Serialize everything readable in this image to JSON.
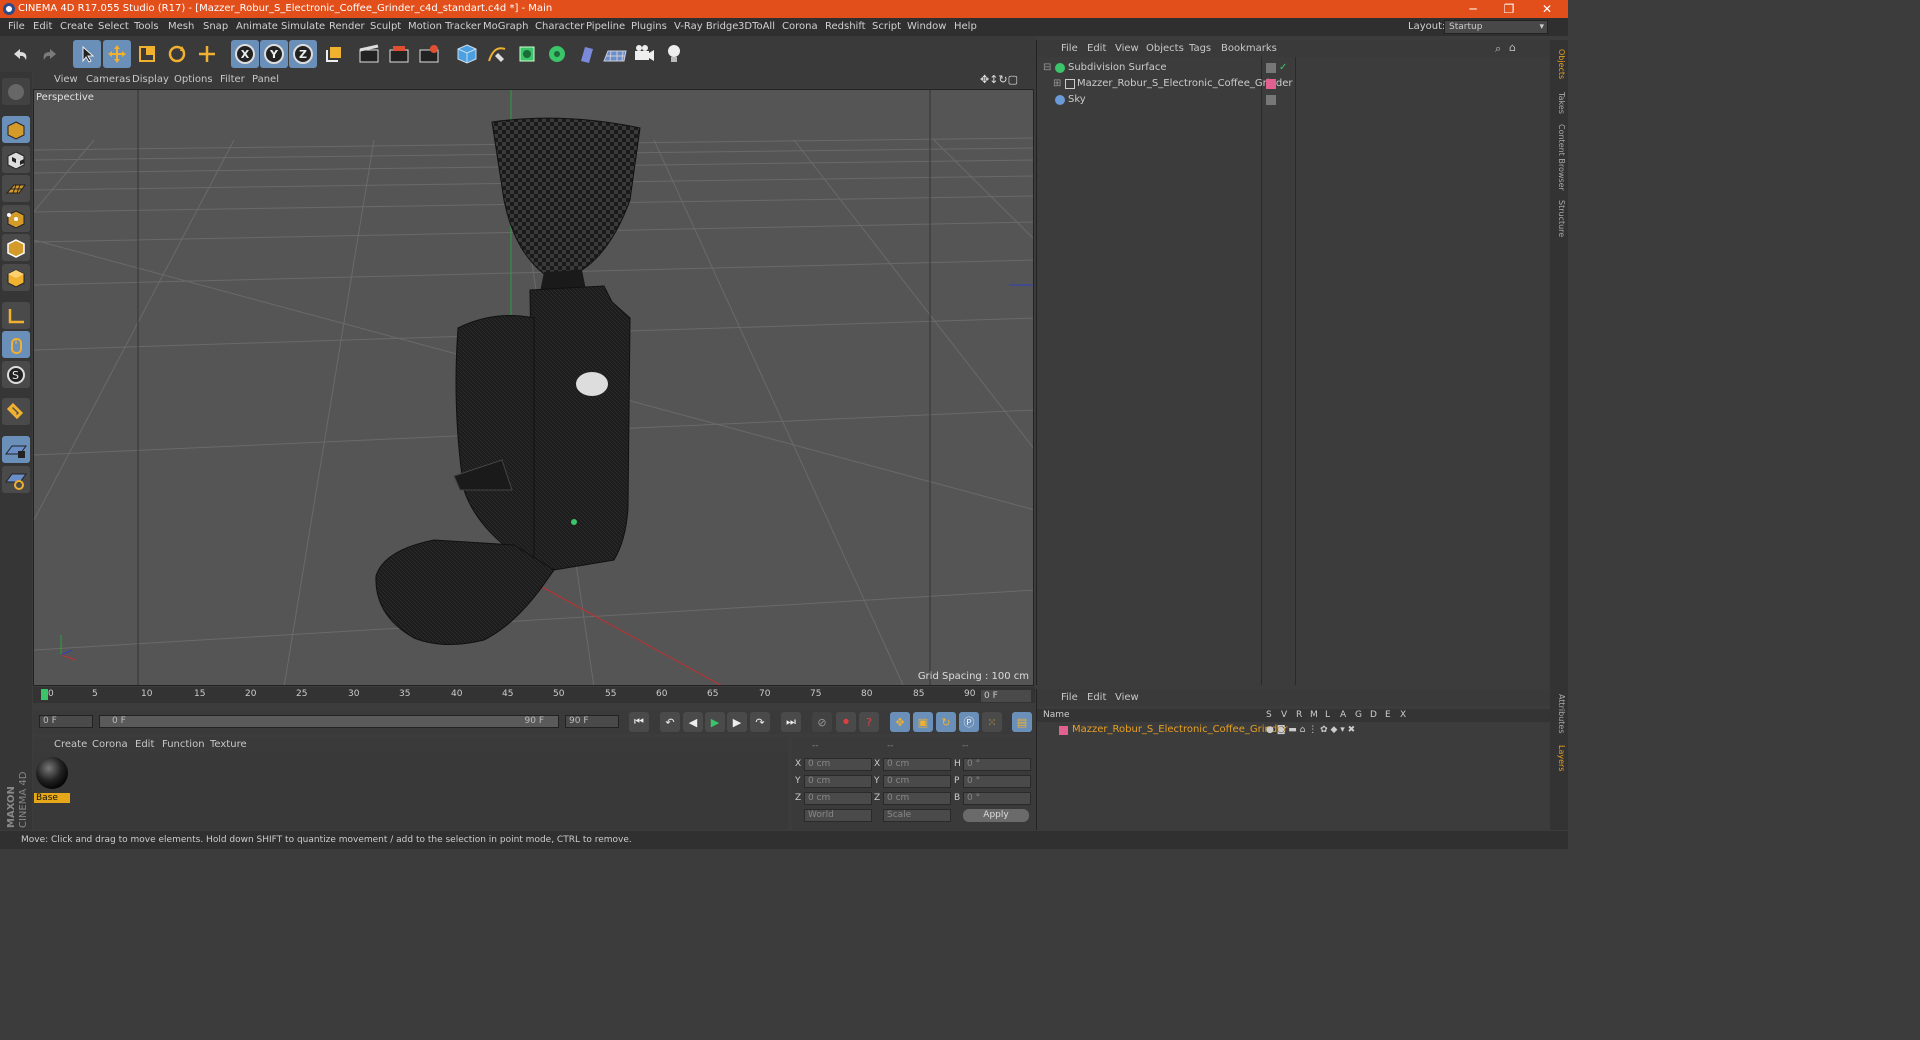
{
  "window": {
    "title": "CINEMA 4D R17.055 Studio (R17) - [Mazzer_Robur_S_Electronic_Coffee_Grinder_c4d_standart.c4d *] - Main",
    "minimize": "─",
    "restore": "❐",
    "close": "✕"
  },
  "menu": [
    "File",
    "Edit",
    "Create",
    "Select",
    "Tools",
    "Mesh",
    "Snap",
    "Animate",
    "Simulate",
    "Render",
    "Sculpt",
    "Motion Tracker",
    "MoGraph",
    "Character",
    "Pipeline",
    "Plugins",
    "V-Ray Bridge",
    "3DToAll",
    "Corona",
    "Redshift",
    "Script",
    "Window",
    "Help"
  ],
  "layout": {
    "label": "Layout:",
    "value": "Startup"
  },
  "toolbar": {
    "axis_x": "X",
    "axis_y": "Y",
    "axis_z": "Z"
  },
  "viewport": {
    "menu": [
      "View",
      "Cameras",
      "Display",
      "Options",
      "Filter",
      "Panel"
    ],
    "label": "Perspective",
    "grid_spacing": "Grid Spacing : 100 cm"
  },
  "timeline": {
    "ticks": [
      "0",
      "5",
      "10",
      "15",
      "20",
      "25",
      "30",
      "35",
      "40",
      "45",
      "50",
      "55",
      "60",
      "65",
      "70",
      "75",
      "80",
      "85",
      "90"
    ],
    "current_frame": "0 F"
  },
  "playback": {
    "start": "0 F",
    "range_start": "0 F",
    "range_end": "90 F",
    "end": "90 F"
  },
  "materials": {
    "menu": [
      "Create",
      "Corona",
      "Edit",
      "Function",
      "Texture"
    ],
    "items": [
      {
        "name": "Base"
      }
    ]
  },
  "coordinates": {
    "header": [
      "--",
      "--",
      "--"
    ],
    "rows": [
      {
        "l1": "X",
        "v1": "0 cm",
        "l2": "X",
        "v2": "0 cm",
        "l3": "H",
        "v3": "0 °"
      },
      {
        "l1": "Y",
        "v1": "0 cm",
        "l2": "Y",
        "v2": "0 cm",
        "l3": "P",
        "v3": "0 °"
      },
      {
        "l1": "Z",
        "v1": "0 cm",
        "l2": "Z",
        "v2": "0 cm",
        "l3": "B",
        "v3": "0 °"
      }
    ],
    "mode": "World",
    "scale": "Scale",
    "apply": "Apply"
  },
  "objects": {
    "menu": [
      "File",
      "Edit",
      "View",
      "Objects",
      "Tags",
      "Bookmarks"
    ],
    "items": [
      {
        "name": "Subdivision Surface",
        "color": "#3bc46a"
      },
      {
        "name": "Mazzer_Robur_S_Electronic_Coffee_Grinder",
        "color": "#e06090"
      },
      {
        "name": "Sky",
        "color": "#6a9ad8"
      }
    ]
  },
  "layers": {
    "menu": [
      "File",
      "Edit",
      "View"
    ],
    "columns": [
      "Name",
      "S",
      "V",
      "R",
      "M",
      "L",
      "A",
      "G",
      "D",
      "E",
      "X"
    ],
    "items": [
      {
        "name": "Mazzer_Robur_S_Electronic_Coffee_Grinder",
        "color": "#e06090"
      }
    ]
  },
  "right_tabs": [
    "Objects",
    "Takes",
    "Content Browser",
    "Structure",
    "Attributes",
    "Layers"
  ],
  "brand": "MAXON CINEMA 4D",
  "status": "Move: Click and drag to move elements. Hold down SHIFT to quantize movement / add to the selection in point mode, CTRL to remove."
}
